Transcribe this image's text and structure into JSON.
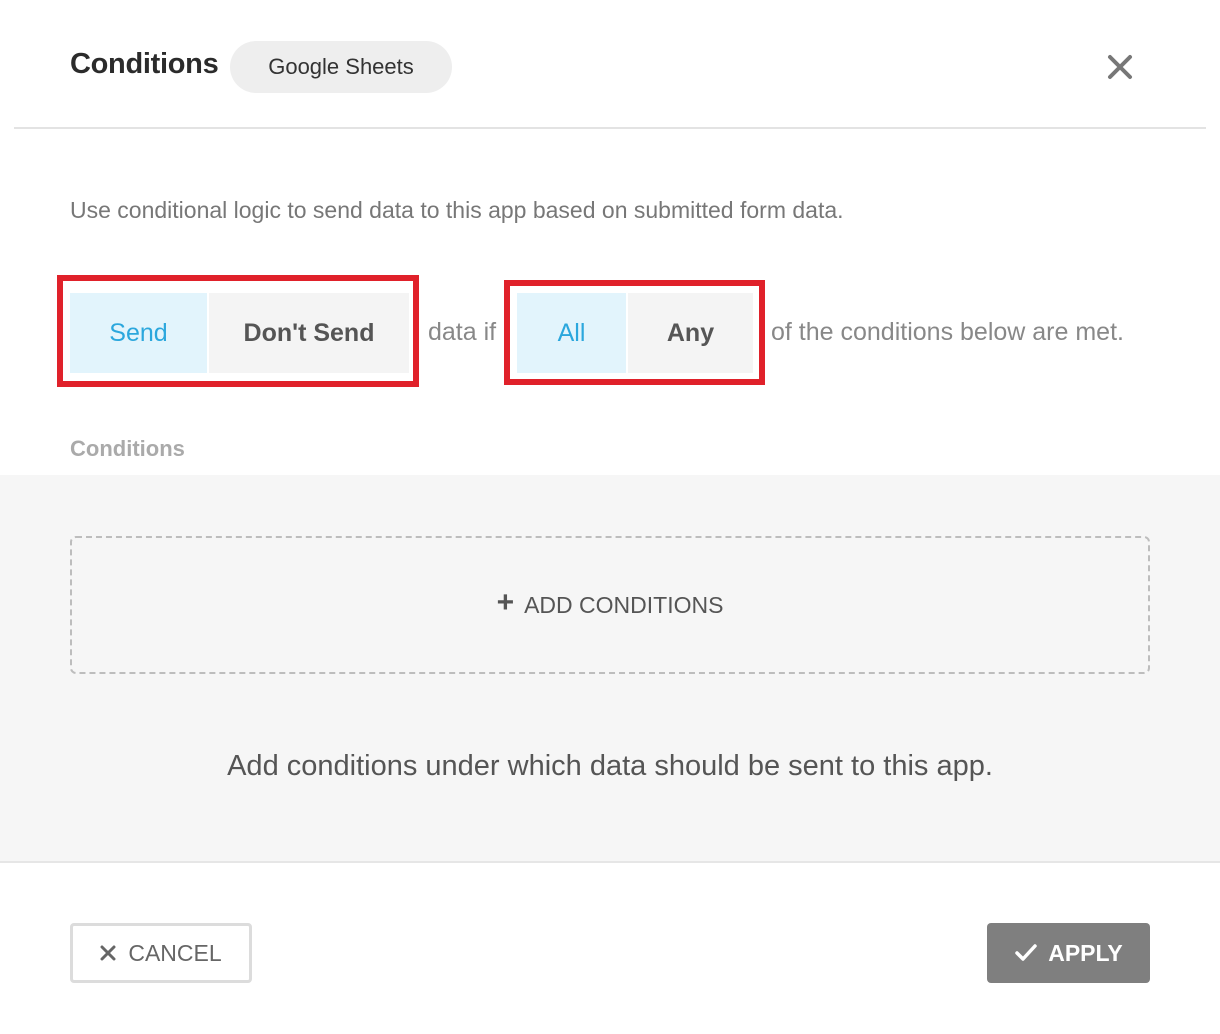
{
  "header": {
    "title": "Conditions",
    "app_name": "Google Sheets",
    "close_icon": "close-icon"
  },
  "description": "Use conditional logic to send data to this app based on submitted form data.",
  "logic": {
    "send_label": "Send",
    "dont_send_label": "Don't Send",
    "send_selected": "Send",
    "data_if_text": "data if",
    "all_label": "All",
    "any_label": "Any",
    "match_selected": "All",
    "met_text": "of the conditions below are met."
  },
  "conditions": {
    "section_label": "Conditions",
    "add_label": "ADD CONDITIONS",
    "empty_message": "Add conditions under which data should be sent to this app."
  },
  "footer": {
    "cancel_label": "CANCEL",
    "apply_label": "APPLY"
  },
  "colors": {
    "active_bg": "#e2f4fc",
    "active_text": "#2ba7dd",
    "highlight": "#e0212a",
    "apply_bg": "#7f7f7f"
  }
}
